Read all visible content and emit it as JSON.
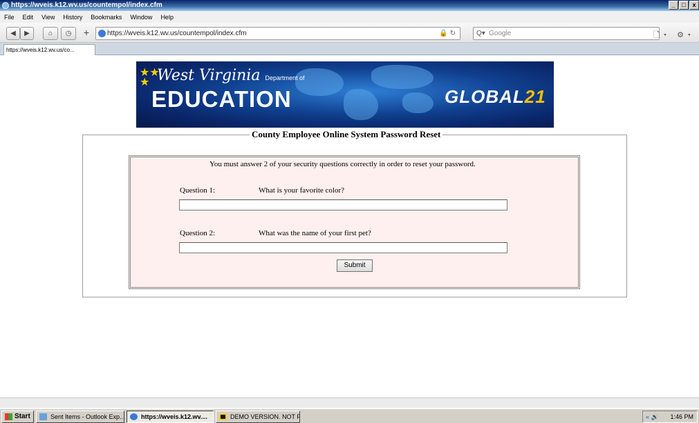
{
  "window": {
    "title": "https://wveis.k12.wv.us/countempol/index.cfm",
    "controls": [
      "_",
      "□",
      "x"
    ]
  },
  "menu": [
    "File",
    "Edit",
    "View",
    "History",
    "Bookmarks",
    "Window",
    "Help"
  ],
  "toolbar": {
    "back": "◀",
    "forward": "▶",
    "home": "⌂",
    "history": "◷",
    "new_tab": "+",
    "url": "https://wveis.k12.wv.us/countempol/index.cfm",
    "url_right_icons": "🔒 ↻",
    "search_placeholder": "Google",
    "search_engine_icon": "Q▾",
    "right_tools": "🗋▾ ⚙▾"
  },
  "tab": {
    "label": "https://wveis.k12.wv.us/co..."
  },
  "banner": {
    "line1": "West Virginia",
    "line1_small": "Department of",
    "line2": "EDUCATION",
    "global_left": "GLOBAL",
    "global_right": "21",
    "colors": {
      "bg": "#0a2568",
      "accent": "#f5c000"
    }
  },
  "form": {
    "legend": "County Employee Online System Password Reset",
    "intro": "You must answer 2 of your security questions correctly in order to reset your password.",
    "questions": [
      {
        "label": "Question 1:",
        "text": "What is your favorite color?",
        "answer": ""
      },
      {
        "label": "Question 2:",
        "text": "What was the name of your first pet?",
        "answer": ""
      }
    ],
    "submit_label": "Submit",
    "box_bg": "#fdf0ee"
  },
  "taskbar": {
    "start": "Start",
    "items": [
      {
        "label": "Sent Items - Outlook Exp...",
        "active": false
      },
      {
        "label": "https://wveis.k12.wv....",
        "active": true
      },
      {
        "label": "DEMO VERSION. NOT F...",
        "active": false
      }
    ],
    "tray_icons": "« 🔊",
    "clock": "1:46 PM"
  }
}
